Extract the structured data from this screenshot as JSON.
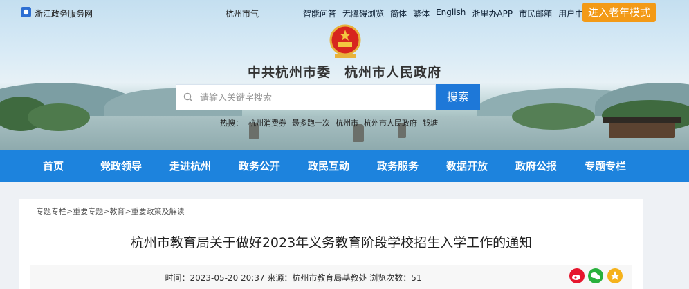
{
  "topbar": {
    "site_name": "浙江政务服务网",
    "weather": "杭州市气",
    "links": [
      "智能问答",
      "无障碍浏览",
      "简体",
      "繁体",
      "English",
      "浙里办APP",
      "市民邮箱",
      "用户中心"
    ],
    "elder_mode_button": "进入老年模式"
  },
  "header": {
    "title": "中共杭州市委　杭州市人民政府"
  },
  "search": {
    "placeholder": "请输入关键字搜索",
    "button_label": "搜索",
    "hot_words": [
      "热搜：",
      "杭州消费券",
      "最多跑一次",
      "杭州市",
      "杭州市人民政府",
      "钱塘"
    ]
  },
  "nav": {
    "items": [
      "首页",
      "党政领导",
      "走进杭州",
      "政务公开",
      "政民互动",
      "政务服务",
      "数据开放",
      "政府公报",
      "专题专栏"
    ]
  },
  "breadcrumb": [
    "专题专栏",
    "重要专题",
    "教育",
    "重要政策及解读"
  ],
  "breadcrumb_separator": ">",
  "article": {
    "title": "杭州市教育局关于做好2023年义务教育阶段学校招生入学工作的通知",
    "meta": "时间：2023-05-20 20:37 来源：杭州市教育局基教处 浏览次数：51"
  },
  "share": {
    "icons": [
      "weibo-icon",
      "wechat-icon",
      "favorite-icon"
    ],
    "colors": {
      "weibo": "#e6162d",
      "wechat": "#28b03c",
      "favorite": "#f5b21b"
    }
  },
  "colors": {
    "nav": "#1d83dd",
    "search_button": "#1e78d8",
    "elder_button": "#f39a16"
  }
}
